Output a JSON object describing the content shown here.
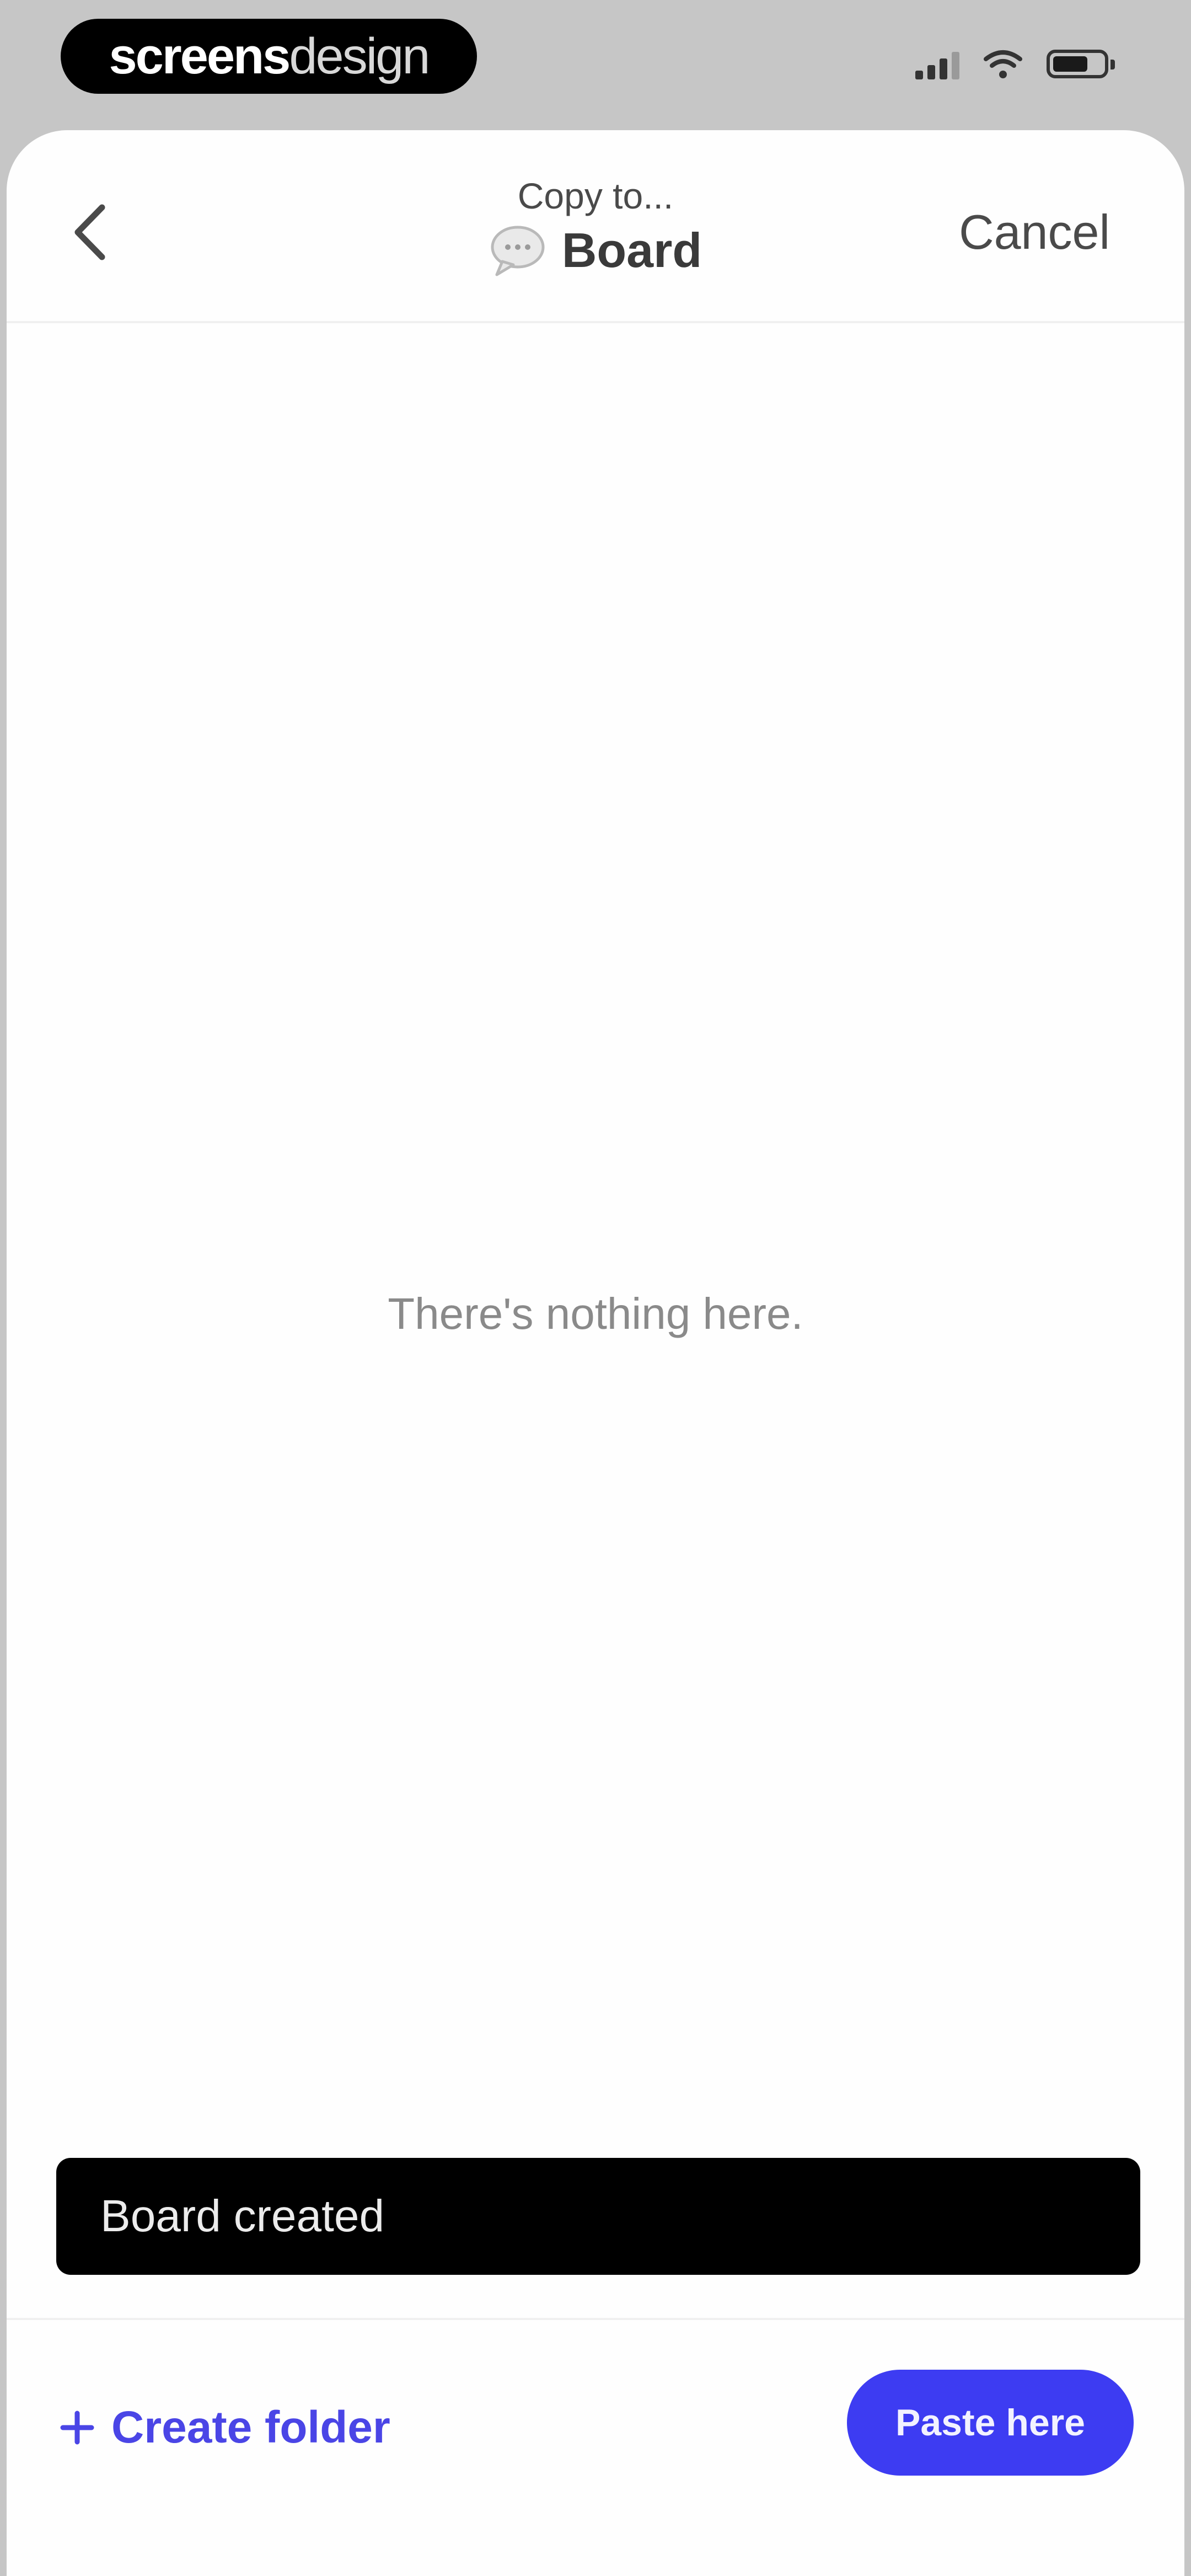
{
  "status_bar": {
    "watermark_bold": "screens",
    "watermark_light": "design",
    "battery_level": 0.7
  },
  "header": {
    "subtitle": "Copy to...",
    "title": "Board",
    "title_icon": "speech-bubble-icon",
    "back_icon": "chevron-left-icon",
    "cancel_label": "Cancel"
  },
  "content": {
    "empty_message": "There's nothing here."
  },
  "toast": {
    "message": "Board created"
  },
  "footer": {
    "create_folder_icon": "plus-icon",
    "create_folder_label": "Create folder",
    "paste_label": "Paste here"
  },
  "colors": {
    "accent": "#3d3cf2",
    "link": "#4a45e6",
    "toast_bg": "#000000",
    "outer_bg": "#c6c6c6"
  }
}
